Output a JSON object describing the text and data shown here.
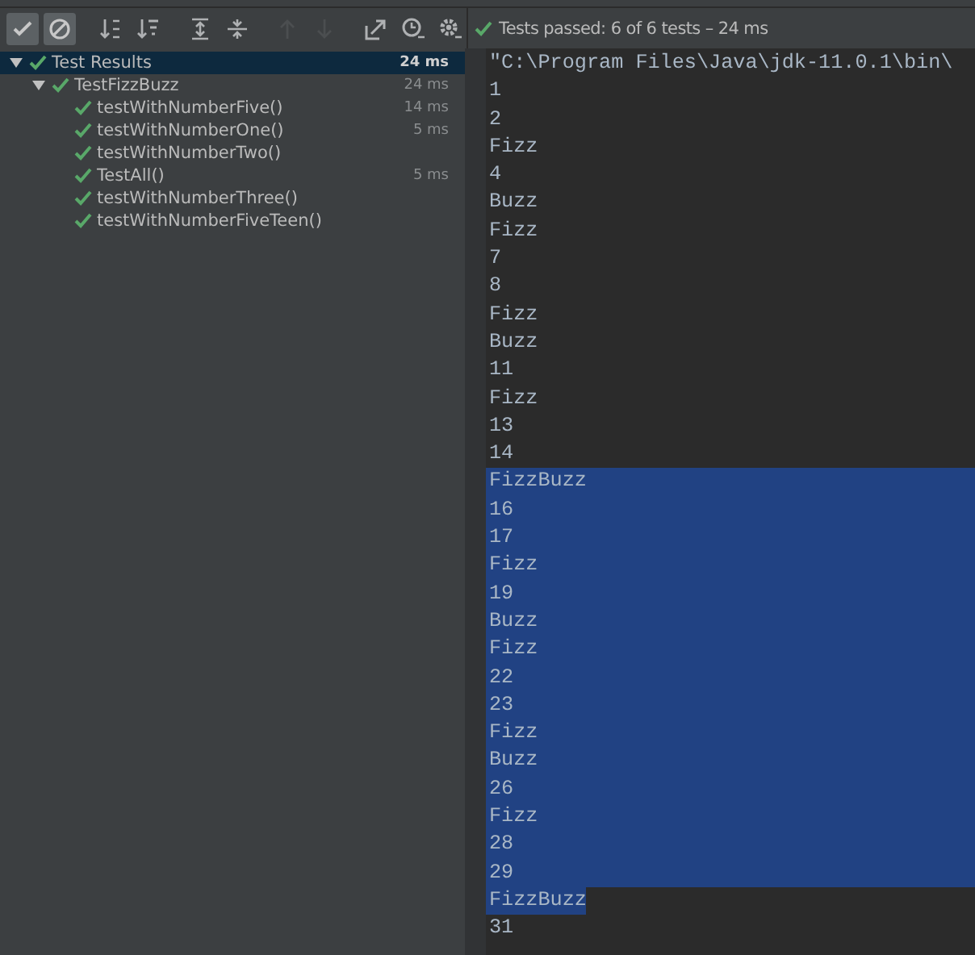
{
  "toolbar": {
    "buttons": [
      {
        "on": true,
        "disabled": false
      },
      {
        "on": true,
        "disabled": false
      },
      {
        "on": false,
        "disabled": false
      },
      {
        "on": false,
        "disabled": false
      },
      {
        "on": false,
        "disabled": false
      },
      {
        "on": false,
        "disabled": false
      },
      {
        "on": false,
        "disabled": true
      },
      {
        "on": false,
        "disabled": true
      },
      {
        "on": false,
        "disabled": false
      },
      {
        "on": false,
        "disabled": false
      },
      {
        "on": false,
        "disabled": false
      }
    ]
  },
  "tree": [
    {
      "label": "Test Results",
      "time": "24 ms",
      "passed": true,
      "expanded": true,
      "selected": true,
      "children": [
        {
          "label": "TestFizzBuzz",
          "time": "24 ms",
          "passed": true,
          "expanded": true,
          "selected": false,
          "children": [
            {
              "label": "testWithNumberFive()",
              "time": "14 ms",
              "passed": true,
              "selected": false
            },
            {
              "label": "testWithNumberOne()",
              "time": "5 ms",
              "passed": true,
              "selected": false
            },
            {
              "label": "testWithNumberTwo()",
              "passed": true,
              "selected": false
            },
            {
              "label": "TestAll()",
              "time": "5 ms",
              "passed": true,
              "selected": false
            },
            {
              "label": "testWithNumberThree()",
              "passed": true,
              "selected": false
            },
            {
              "label": "testWithNumberFiveTeen()",
              "passed": true,
              "selected": false
            }
          ]
        }
      ]
    }
  ],
  "status": {
    "passed": true,
    "text": "Tests passed:",
    "count": "6 of 6 tests",
    "time": "– 24 ms"
  },
  "console": [
    {
      "text": "\"C:\\Program Files\\Java\\jdk-11.0.1\\bin\\",
      "selected": false
    },
    {
      "text": "1",
      "selected": false
    },
    {
      "text": "2",
      "selected": false
    },
    {
      "text": "Fizz",
      "selected": false
    },
    {
      "text": "4",
      "selected": false
    },
    {
      "text": "Buzz",
      "selected": false
    },
    {
      "text": "Fizz",
      "selected": false
    },
    {
      "text": "7",
      "selected": false
    },
    {
      "text": "8",
      "selected": false
    },
    {
      "text": "Fizz",
      "selected": false
    },
    {
      "text": "Buzz",
      "selected": false
    },
    {
      "text": "11",
      "selected": false
    },
    {
      "text": "Fizz",
      "selected": false
    },
    {
      "text": "13",
      "selected": false
    },
    {
      "text": "14",
      "selected": false
    },
    {
      "text": "FizzBuzz",
      "selected": true
    },
    {
      "text": "16",
      "selected": true
    },
    {
      "text": "17",
      "selected": true
    },
    {
      "text": "Fizz",
      "selected": true
    },
    {
      "text": "19",
      "selected": true
    },
    {
      "text": "Buzz",
      "selected": true
    },
    {
      "text": "Fizz",
      "selected": true
    },
    {
      "text": "22",
      "selected": true
    },
    {
      "text": "23",
      "selected": true
    },
    {
      "text": "Fizz",
      "selected": true
    },
    {
      "text": "Buzz",
      "selected": true
    },
    {
      "text": "26",
      "selected": true
    },
    {
      "text": "Fizz",
      "selected": true
    },
    {
      "text": "28",
      "selected": true
    },
    {
      "text": "29",
      "selected": true
    },
    {
      "text": "FizzBuzz",
      "selected": true
    },
    {
      "text": "31",
      "selected": false
    }
  ]
}
